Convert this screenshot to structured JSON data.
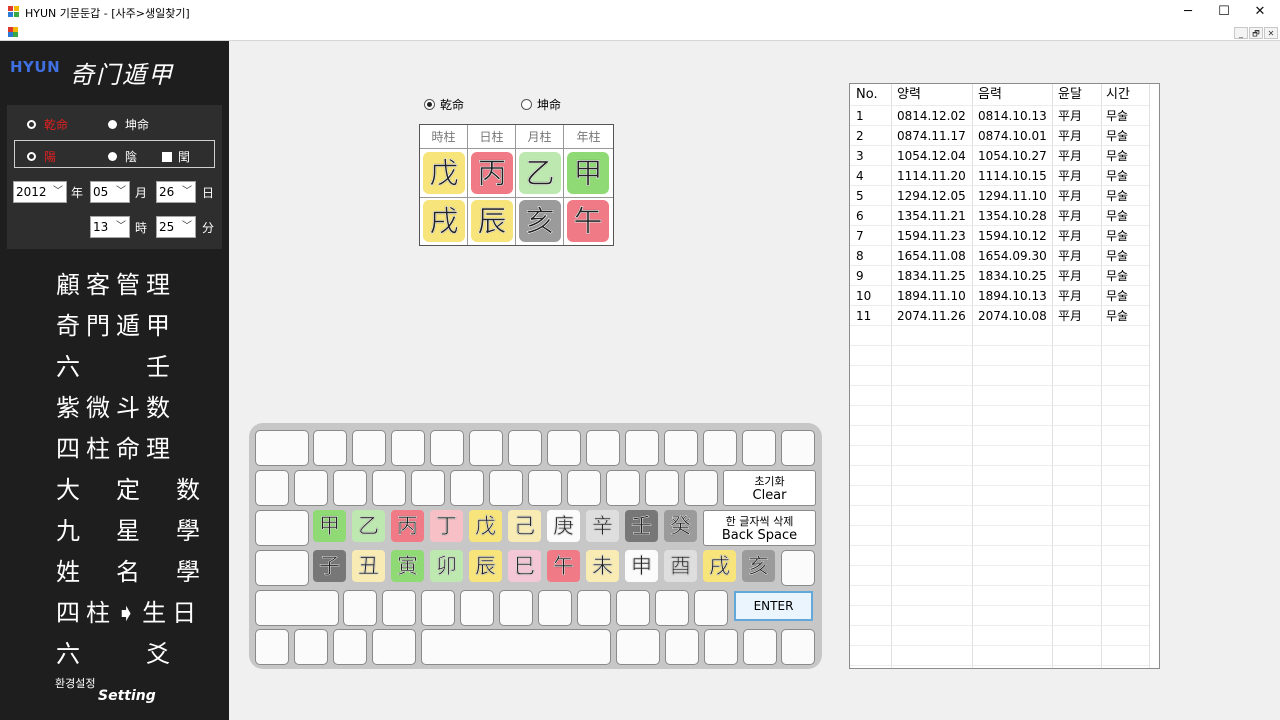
{
  "window": {
    "title": "HYUN 기문둔갑 - [사주>생일찾기]",
    "controls": [
      "─",
      "☐",
      "✕"
    ],
    "mdi_controls": [
      "_",
      "🗗",
      "✕"
    ]
  },
  "sidebar": {
    "logo_brand": "HYUN",
    "logo_script": "奇门遁甲",
    "gender_options": [
      "乾命",
      "坤命"
    ],
    "calendar_options": [
      "陽",
      "陰"
    ],
    "leap_label": "閏",
    "date": {
      "year": "2012",
      "year_unit": "年",
      "month": "05",
      "month_unit": "月",
      "day": "26",
      "day_unit": "日"
    },
    "time": {
      "hour": "13",
      "hour_unit": "時",
      "minute": "25",
      "minute_unit": "分"
    },
    "menu_items": [
      "顧客管理",
      "奇門遁甲",
      "六　　壬",
      "紫微斗数",
      "四柱命理",
      "大　定　数",
      "九　星　學",
      "姓　名　學",
      "四柱➧生日",
      "六　　爻"
    ],
    "setting_ko": "환경설정",
    "setting_en": "Setting"
  },
  "main": {
    "gender_radio": [
      "乾命",
      "坤命"
    ],
    "pillars": {
      "headers": [
        "時柱",
        "日柱",
        "月柱",
        "年柱"
      ],
      "stems": [
        "戊",
        "丙",
        "乙",
        "甲"
      ],
      "branches": [
        "戌",
        "辰",
        "亥",
        "午"
      ]
    },
    "keyboard": {
      "stems": [
        "甲",
        "乙",
        "丙",
        "丁",
        "戊",
        "己",
        "庚",
        "辛",
        "壬",
        "癸"
      ],
      "branches": [
        "子",
        "丑",
        "寅",
        "卯",
        "辰",
        "巳",
        "午",
        "未",
        "申",
        "酉",
        "戌",
        "亥"
      ],
      "clear_ko": "초기화",
      "clear_en": "Clear",
      "backspace_ko": "한 글자씩 삭제",
      "backspace_en": "Back Space",
      "enter": "ENTER"
    }
  },
  "results": {
    "columns": [
      "No.",
      "양력",
      "음력",
      "윤달",
      "시간"
    ],
    "rows": [
      [
        "1",
        "0814.12.02",
        "0814.10.13",
        "平月",
        "무술"
      ],
      [
        "2",
        "0874.11.17",
        "0874.10.01",
        "平月",
        "무술"
      ],
      [
        "3",
        "1054.12.04",
        "1054.10.27",
        "平月",
        "무술"
      ],
      [
        "4",
        "1114.11.20",
        "1114.10.15",
        "平月",
        "무술"
      ],
      [
        "5",
        "1294.12.05",
        "1294.11.10",
        "平月",
        "무술"
      ],
      [
        "6",
        "1354.11.21",
        "1354.10.28",
        "平月",
        "무술"
      ],
      [
        "7",
        "1594.11.23",
        "1594.10.12",
        "平月",
        "무술"
      ],
      [
        "8",
        "1654.11.08",
        "1654.09.30",
        "平月",
        "무술"
      ],
      [
        "9",
        "1834.11.25",
        "1834.10.25",
        "平月",
        "무술"
      ],
      [
        "10",
        "1894.11.10",
        "1894.10.13",
        "平月",
        "무술"
      ],
      [
        "11",
        "2074.11.26",
        "2074.10.08",
        "平月",
        "무술"
      ]
    ]
  }
}
